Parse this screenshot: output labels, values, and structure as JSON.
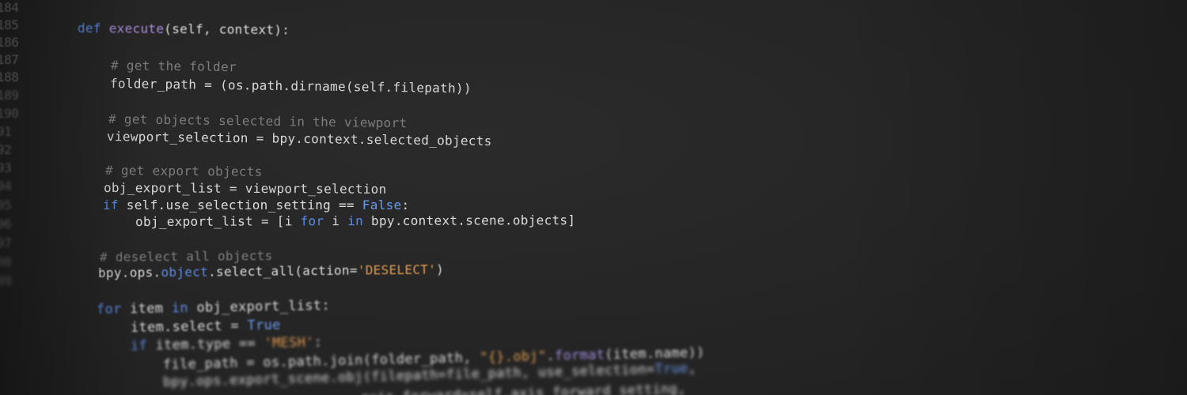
{
  "editor": {
    "theme_colors": {
      "background": "#262626",
      "keyword": "#5c8be6",
      "function": "#a98be0",
      "comment": "#7d7d7d",
      "string": "#e09a4f",
      "text": "#dcdcdc"
    },
    "line_numbers": [
      "184",
      "185",
      "186",
      "187",
      "188",
      "189",
      "190",
      "91",
      "92",
      "93",
      "94",
      "95",
      "96",
      "97",
      "98",
      "99"
    ],
    "code": {
      "l185": {
        "kw": "def",
        "fn": "execute",
        "rest": "(self, context):"
      },
      "l187": {
        "comment": "# get the folder"
      },
      "l188": {
        "text": "folder_path = (os.path.dirname(self.filepath))"
      },
      "l190": {
        "comment": "# get objects selected in the viewport"
      },
      "l191": {
        "text": "viewport_selection = bpy.context.selected_objects"
      },
      "l193": {
        "comment": "# get export objects"
      },
      "l194": {
        "text": "obj_export_list = viewport_selection"
      },
      "l195": {
        "kw": "if",
        "mid": " self.use_selection_setting == ",
        "bool": "False",
        "end": ":"
      },
      "l196": {
        "pre": "obj_export_list = [i ",
        "kw1": "for",
        "mid": " i ",
        "kw2": "in",
        "end": " bpy.context.scene.objects]"
      },
      "l198": {
        "comment": "# deselect all objects"
      },
      "l199": {
        "pre": "bpy.ops.",
        "kw": "object",
        "mid": ".select_all(action=",
        "str": "'DESELECT'",
        "end": ")"
      },
      "l201": {
        "kw1": "for",
        "mid": " item ",
        "kw2": "in",
        "end": " obj_export_list:"
      },
      "l202": {
        "pre": "item.select = ",
        "bool": "True"
      },
      "l203": {
        "kw": "if",
        "mid": " item.type == ",
        "str": "'MESH'",
        "end": ":"
      },
      "l203b": {
        "pre": "",
        "str": "\"{}.obj\"",
        "dot": ".",
        "fn": "format",
        "end": "(item.name))"
      },
      "l204": {
        "pre": "file_path = os.path.join(folder_path, "
      },
      "l205": {
        "pre": "bpy.ops.export_scene.obj(filepath=file_path, use_selection=",
        "bool": "True",
        "end": ","
      },
      "l206": {
        "text": "axis_forward=self.axis_forward_setting,"
      }
    }
  }
}
